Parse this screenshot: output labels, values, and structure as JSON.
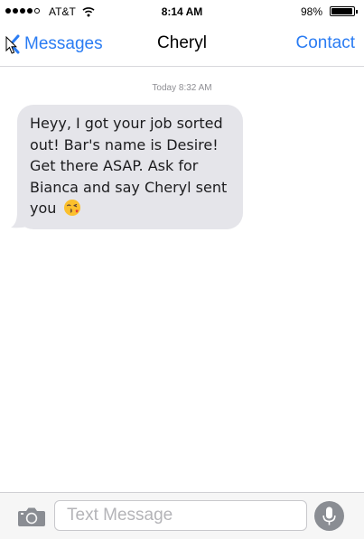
{
  "status_bar": {
    "carrier": "AT&T",
    "time": "8:14 AM",
    "battery_percent": "98%",
    "battery_level": 0.98,
    "signal_bars_filled": 4,
    "signal_bars_total": 5
  },
  "nav": {
    "back_label": "Messages",
    "title": "Cheryl",
    "right_label": "Contact"
  },
  "conversation": {
    "timestamp": "Today 8:32 AM",
    "messages": [
      {
        "sender": "incoming",
        "text": "Heyy, I got your job sorted out! Bar's name is Desire! Get there ASAP. Ask for Bianca and say Cheryl sent you",
        "emoji": "face-blowing-kiss"
      }
    ]
  },
  "input_bar": {
    "placeholder": "Text Message",
    "value": ""
  },
  "colors": {
    "accent": "#2a7cf3",
    "bubble_incoming": "#e5e5ea",
    "timestamp": "#8e8e93",
    "mic_button": "#8a8d93"
  },
  "icons": {
    "back": "chevron-left-icon",
    "camera": "camera-icon",
    "mic": "microphone-icon",
    "wifi": "wifi-icon",
    "battery": "battery-icon"
  }
}
